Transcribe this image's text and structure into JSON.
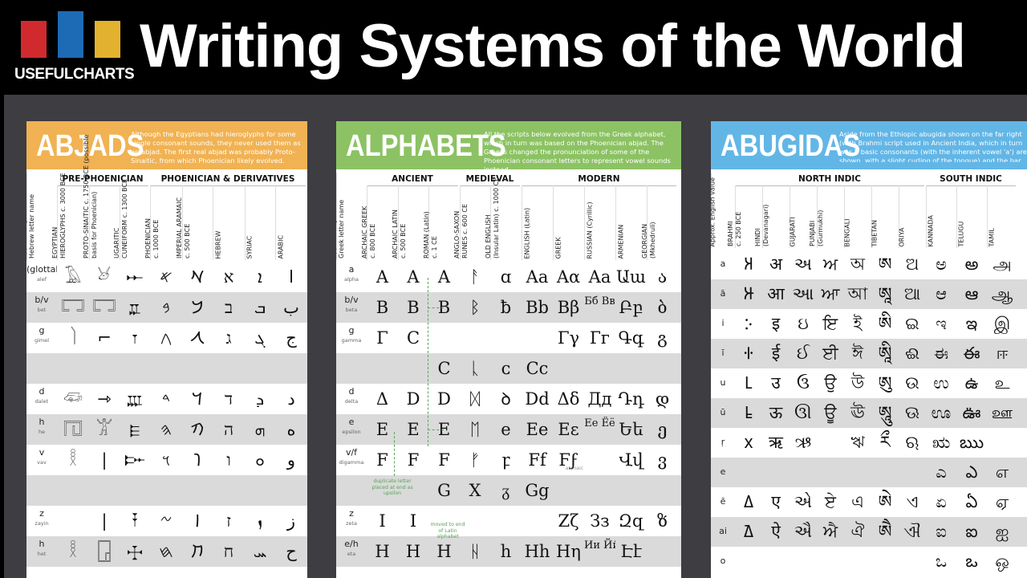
{
  "header": {
    "logo_text": "USEFULCHARTS",
    "logo_colors": [
      "#d12a2e",
      "#1d6bb5",
      "#e2b22f"
    ],
    "title": "Writing Systems of the World"
  },
  "colors": {
    "abjads": "#f0b253",
    "alphabets": "#8cc263",
    "abugidas": "#62b6e6",
    "stage_background": "#3d3d42",
    "alt_row": "#dadada"
  },
  "abjads": {
    "name": "ABJADS",
    "description": "Although the Egyptians had hieroglyphs for some single consonant sounds, they never used them as an abjad. The first real abjad was probably Proto-Sinaitic, from which Phoenician likely evolved.",
    "groups": [
      "PRE-PHOENICIAN",
      "PHOENICIAN & DERIVATIVES"
    ],
    "columns": [
      {
        "title": "Approx. English value +",
        "sub": "Hebrew letter name"
      },
      {
        "title": "EGYPTIAN",
        "sub": "HIEROGLYPHS c. 3000 BCE"
      },
      {
        "title": "PROTO-SINAITIC c. 1750 BCE (possible",
        "sub": "basis for Phoenician)"
      },
      {
        "title": "UGARITIC",
        "sub": "CUNEIFORM c. 1300 BCE"
      },
      {
        "title": "PHOENICIAN",
        "sub": "c. 1000 BCE"
      },
      {
        "title": "IMPERIAL ARAMAIC",
        "sub": "c. 500 BCE"
      },
      {
        "title": "HEBREW",
        "sub": ""
      },
      {
        "title": "SYRIAC",
        "sub": ""
      },
      {
        "title": "ARABIC",
        "sub": ""
      }
    ],
    "rows": [
      {
        "label": "(glottal stop)",
        "name": "alef",
        "cells": [
          "𓄿",
          "𓃾",
          "𐎀",
          "𐤀",
          "𐡀",
          "א",
          "ܐ",
          "ا"
        ]
      },
      {
        "label": "b/v",
        "name": "bet",
        "cells": [
          "𓉐",
          "𓉐",
          "𐎁",
          "𐤁",
          "𐡁",
          "ב",
          "ܒ",
          "ب"
        ]
      },
      {
        "label": "g",
        "name": "gimel",
        "cells": [
          "𓌙",
          "⌐",
          "𐎂",
          "𐤂",
          "𐡂",
          "ג",
          "ܓ",
          "ج"
        ]
      },
      {
        "label": "",
        "name": "",
        "cells": [
          "",
          "",
          "",
          "",
          "",
          "",
          "",
          ""
        ]
      },
      {
        "label": "d",
        "name": "dalet",
        "cells": [
          "𓆛",
          "⇾",
          "𐎄",
          "𐤃",
          "𐡃",
          "ד",
          "ܕ",
          "د"
        ]
      },
      {
        "label": "h",
        "name": "he",
        "cells": [
          "𓉔",
          "𓀠",
          "𐎅",
          "𐤄",
          "𐡄",
          "ה",
          "ܗ",
          "ه"
        ]
      },
      {
        "label": "v",
        "name": "vav",
        "cells": [
          "𓎛",
          "|",
          "𐎆",
          "𐤅",
          "𐡅",
          "ו",
          "ܘ",
          "و"
        ]
      },
      {
        "label": "",
        "name": "",
        "cells": [
          "",
          "",
          "",
          "",
          "",
          "",
          "",
          ""
        ]
      },
      {
        "label": "z",
        "name": "zayin",
        "cells": [
          "",
          "|",
          "𐎇",
          "𐤆",
          "𐡆",
          "ז",
          "ܙ",
          "ز"
        ]
      },
      {
        "label": "h",
        "name": "het",
        "cells": [
          "𓎛",
          "𓉗",
          "𐎈",
          "𐤇",
          "𐡇",
          "ח",
          "ܚ",
          "ح"
        ]
      }
    ]
  },
  "alphabets": {
    "name": "ALPHABETS",
    "description": "All the scripts below evolved from the Greek alphabet, which in turn was based on the Phoenician abjad. The Greeks changed the pronunciation of some of the Phoenician consonant letters to represent vowel sounds instead.",
    "groups": [
      "ANCIENT",
      "MEDIEVAL",
      "MODERN"
    ],
    "columns": [
      {
        "title": "Approx. English value +",
        "sub": "Greek letter name"
      },
      {
        "title": "ARCHAIC GREEK",
        "sub": "c. 800 BCE"
      },
      {
        "title": "ARCHAIC LATIN",
        "sub": "c. 500 BCE"
      },
      {
        "title": "ROMAN (Latin)",
        "sub": "c. 1 CE"
      },
      {
        "title": "ANGLO-SAXON",
        "sub": "RUNES c. 600 CE"
      },
      {
        "title": "OLD ENGLISH",
        "sub": "(Insular Latin) c. 1000 CE"
      },
      {
        "title": "ENGLISH (Latin)",
        "sub": ""
      },
      {
        "title": "GREEK",
        "sub": ""
      },
      {
        "title": "RUSSIAN (Cyrillic)",
        "sub": ""
      },
      {
        "title": "ARMENIAN",
        "sub": ""
      },
      {
        "title": "GEORGIAN",
        "sub": "(Mkhedruli)"
      }
    ],
    "rows": [
      {
        "label": "a",
        "name": "alpha",
        "cells": [
          "A",
          "A",
          "A",
          "ᚨ",
          "ɑ",
          "Aa",
          "Αα",
          "Aa",
          "Աա",
          "ა"
        ]
      },
      {
        "label": "b/v",
        "name": "beta",
        "cells": [
          "B",
          "B",
          "B",
          "ᛒ",
          "ƀ",
          "Bb",
          "Ββ",
          "Бб Вв",
          "Բբ",
          "ბ"
        ]
      },
      {
        "label": "g",
        "name": "gamma",
        "cells": [
          "Γ",
          "C",
          "",
          "",
          "",
          "",
          "Γγ",
          "Гг",
          "Գգ",
          "გ"
        ]
      },
      {
        "label": "",
        "name": "",
        "cells": [
          "",
          "",
          "C",
          "ᚳ",
          "ᴄ",
          "Cc",
          "",
          "",
          "",
          ""
        ]
      },
      {
        "label": "d",
        "name": "delta",
        "cells": [
          "Δ",
          "D",
          "D",
          "ᛞ",
          "ꝺ",
          "Dd",
          "Δδ",
          "Дд",
          "Դդ",
          "დ"
        ]
      },
      {
        "label": "e",
        "name": "epsilon",
        "cells": [
          "E",
          "E",
          "E",
          "ᛖ",
          "e",
          "Ee",
          "Εε",
          "Ее Ёё",
          "Եե",
          "ე"
        ]
      },
      {
        "label": "v/f",
        "name": "digamma",
        "cells": [
          "F",
          "F",
          "F",
          "ᚠ",
          "ꝼ",
          "Ff",
          "Ϝϝ",
          "",
          "Վվ",
          "ვ"
        ]
      },
      {
        "label": "",
        "name": "",
        "cells": [
          "",
          "",
          "G",
          "X",
          "ᵹ",
          "Gg",
          "",
          "",
          "",
          ""
        ]
      },
      {
        "label": "z",
        "name": "zeta",
        "cells": [
          "I",
          "I",
          "",
          "",
          "",
          "",
          "Ζζ",
          "Зз",
          "Զզ",
          "ზ"
        ]
      },
      {
        "label": "e/h",
        "name": "eta",
        "cells": [
          "H",
          "H",
          "H",
          "ᚺ",
          "h",
          "Hh",
          "Ηη",
          "Ии Йй",
          "Էէ",
          ""
        ]
      }
    ],
    "notes": {
      "duplicate": "duplicate letter placed at end as upsilon",
      "moved": "moved to end of Latin alphabet",
      "archaic": "archaic"
    }
  },
  "abugidas": {
    "name": "ABUGIDAS",
    "description": "Aside from the Ethiopic abugida shown on the far right (with Brahmi script used in Ancient India, which in turn was b basic consonants (with the inherent vowel 'a') are shown. with a slight curling of the tongue) and the bar indicates lo",
    "groups": [
      "NORTH INDIC",
      "SOUTH INDIC"
    ],
    "columns": [
      {
        "title": "Approx. English value",
        "sub": ""
      },
      {
        "title": "BRAHMI",
        "sub": "c. 250 BCE"
      },
      {
        "title": "HINDI",
        "sub": "(Devanagari)"
      },
      {
        "title": "GUJARATI",
        "sub": ""
      },
      {
        "title": "PUNJABI",
        "sub": "(Gurmukhi)"
      },
      {
        "title": "BENGALI",
        "sub": ""
      },
      {
        "title": "TIBETAN",
        "sub": ""
      },
      {
        "title": "ORIYA",
        "sub": ""
      },
      {
        "title": "KANNADA",
        "sub": ""
      },
      {
        "title": "TELUGU",
        "sub": ""
      },
      {
        "title": "TAMIL",
        "sub": ""
      }
    ],
    "rows": [
      {
        "label": "a",
        "cells": [
          "𑀅",
          "अ",
          "અ",
          "ਅ",
          "অ",
          "ཨ",
          "ଅ",
          "ಅ",
          "అ",
          "அ"
        ]
      },
      {
        "label": "ā",
        "cells": [
          "𑀆",
          "आ",
          "આ",
          "ਆ",
          "আ",
          "ཨཱ",
          "ଆ",
          "ಆ",
          "ఆ",
          "ஆ"
        ]
      },
      {
        "label": "i",
        "cells": [
          "𑀇",
          "इ",
          "ઇ",
          "ਇ",
          "ই",
          "ཨི",
          "ଇ",
          "ಇ",
          "ఇ",
          "இ"
        ]
      },
      {
        "label": "ī",
        "cells": [
          "𑀈",
          "ई",
          "ઈ",
          "ਈ",
          "ঈ",
          "ཨཱི",
          "ଈ",
          "ಈ",
          "ఈ",
          "ஈ"
        ]
      },
      {
        "label": "u",
        "cells": [
          "𑀉",
          "उ",
          "ઉ",
          "ਉ",
          "উ",
          "ཨུ",
          "ଉ",
          "ಉ",
          "ఉ",
          "உ"
        ]
      },
      {
        "label": "ū",
        "cells": [
          "𑀊",
          "ऊ",
          "ઊ",
          "ਊ",
          "ঊ",
          "ཨཱུ",
          "ଊ",
          "ಊ",
          "ఊ",
          "ஊ"
        ]
      },
      {
        "label": "ṛ",
        "cells": [
          "𑀋",
          "ऋ",
          "ઋ",
          "",
          "ঋ",
          "རྀ",
          "ଋ",
          "ಋ",
          "ఋ",
          ""
        ]
      },
      {
        "label": "e",
        "cells": [
          "",
          "",
          "",
          "",
          "",
          "",
          "",
          "ಎ",
          "ఎ",
          "எ"
        ]
      },
      {
        "label": "ē",
        "cells": [
          "𑀏",
          "ए",
          "એ",
          "ਏ",
          "এ",
          "ཨེ",
          "ଏ",
          "ಏ",
          "ఏ",
          "ஏ"
        ]
      },
      {
        "label": "ai",
        "cells": [
          "𑀐",
          "ऐ",
          "ઐ",
          "ਐ",
          "ঐ",
          "ཨཻ",
          "ଐ",
          "ಐ",
          "ఐ",
          "ஐ"
        ]
      },
      {
        "label": "o",
        "cells": [
          "",
          "",
          "",
          "",
          "",
          "",
          "",
          "ಒ",
          "ఒ",
          "ஒ"
        ]
      }
    ]
  }
}
